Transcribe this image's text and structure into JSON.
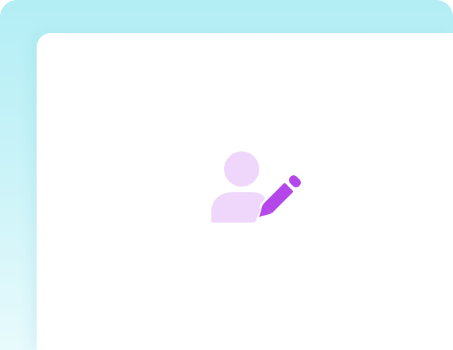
{
  "icon": {
    "name": "user-edit-icon",
    "person_color": "#efd7fb",
    "pencil_color": "#b347ea"
  },
  "colors": {
    "backdrop_top": "#b3eef5",
    "backdrop_bottom": "#e8fafc",
    "panel": "#ffffff"
  }
}
